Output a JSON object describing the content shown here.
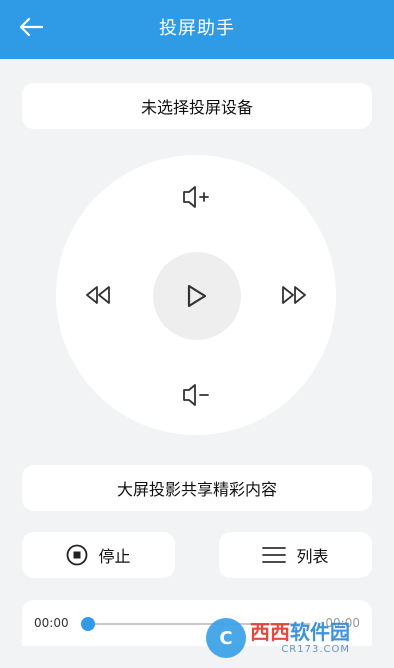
{
  "header": {
    "title": "投屏助手",
    "back_icon": "arrow-left-icon",
    "background": "#2f9ae6"
  },
  "device_select": {
    "label": "未选择投屏设备"
  },
  "controls": {
    "volume_up_icon": "volume-up-icon",
    "volume_down_icon": "volume-down-icon",
    "rewind_icon": "rewind-icon",
    "forward_icon": "fast-forward-icon",
    "play_icon": "play-icon"
  },
  "share": {
    "label": "大屏投影共享精彩内容"
  },
  "actions": {
    "stop_label": "停止",
    "stop_icon": "stop-circle-icon",
    "list_label": "列表",
    "list_icon": "list-icon"
  },
  "progress": {
    "current_time": "00:00",
    "total_time": "00:00",
    "fraction": 0.0,
    "accent": "#2f9ae6"
  },
  "watermark": {
    "brand_red": "西西",
    "brand_blue": "软件园",
    "domain": "CR173.COM"
  }
}
